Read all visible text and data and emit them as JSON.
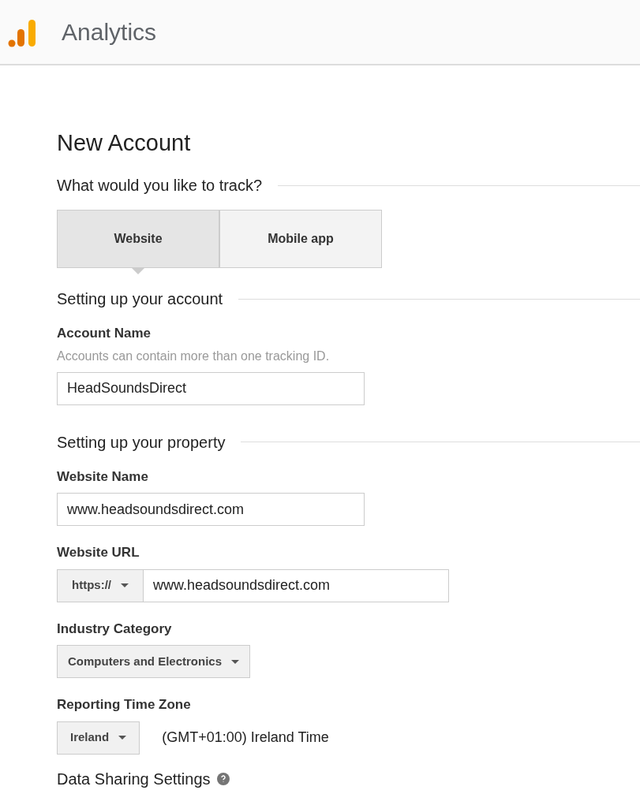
{
  "header": {
    "product": "Analytics"
  },
  "page_title": "New Account",
  "track_section": {
    "heading": "What would you like to track?",
    "tabs": [
      {
        "label": "Website",
        "selected": true
      },
      {
        "label": "Mobile app",
        "selected": false
      }
    ]
  },
  "account_section": {
    "heading": "Setting up your account",
    "fields": [
      {
        "kind": "text",
        "label": "Account Name",
        "hint": "Accounts can contain more than one tracking ID.",
        "value": "HeadSoundsDirect"
      }
    ]
  },
  "property_section": {
    "heading": "Setting up your property",
    "fields": [
      {
        "kind": "text",
        "label": "Website Name",
        "value": "www.headsoundsdirect.com"
      },
      {
        "kind": "url",
        "label": "Website URL",
        "protocol": "https://",
        "value": "www.headsoundsdirect.com"
      },
      {
        "kind": "select",
        "label": "Industry Category",
        "value": "Computers and Electronics"
      },
      {
        "kind": "timezone",
        "label": "Reporting Time Zone",
        "value": "Ireland",
        "note": "(GMT+01:00) Ireland Time"
      }
    ]
  },
  "next_heading": "Data Sharing Settings"
}
